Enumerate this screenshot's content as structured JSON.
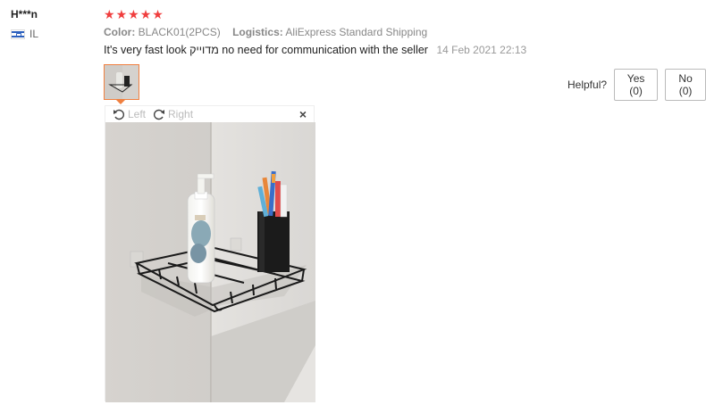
{
  "reviewer": {
    "name": "H***n",
    "country": "IL"
  },
  "rating": {
    "stars": 5
  },
  "meta": {
    "color_label": "Color:",
    "color_value": "BLACK01(2PCS)",
    "logistics_label": "Logistics:",
    "logistics_value": "AliExpress Standard Shipping"
  },
  "review": {
    "text": "It's very fast look מדוייק no need for communication with the seller",
    "date": "14 Feb 2021 22:13"
  },
  "helpful": {
    "label": "Helpful?",
    "yes": "Yes (0)",
    "no": "No (0)"
  },
  "viewer": {
    "left_label": "Left",
    "right_label": "Right",
    "close_symbol": "×"
  },
  "colors": {
    "star": "#f03e3e",
    "thumb_border": "#f08040"
  }
}
